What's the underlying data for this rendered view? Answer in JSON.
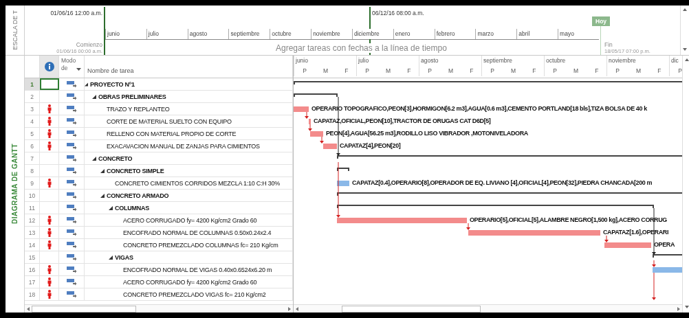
{
  "timeline": {
    "side_label": "ESCALA DE T",
    "start_marker": "01/06/16 12:00 a.m.",
    "end_marker": "06/12/16 08:00 a.m.",
    "months": [
      "junio",
      "julio",
      "agosto",
      "septiembre",
      "octubre",
      "noviembre",
      "diciembre",
      "enero",
      "febrero",
      "marzo",
      "abril",
      "mayo"
    ],
    "start_label": "Comienzo",
    "start_value": "01/06/16 00:00 a.m.",
    "hint": "Agregar tareas con fechas a la línea de tiempo",
    "today": "Hoy",
    "finish_label": "Fin",
    "finish_value": "18/05/17 07:00 p.m."
  },
  "view_label": "DIAGRAMA DE GANTT",
  "table": {
    "columns": {
      "mode": "Modo de",
      "name": "Nombre de tarea"
    },
    "rows": [
      {
        "number": "1",
        "name": "PROYECTO Nº1",
        "kind": "summary",
        "expanded": true,
        "selected": true,
        "overallocated": false,
        "children": [
          {
            "number": "2",
            "name": "OBRAS PRELIMINARES",
            "kind": "summary",
            "expanded": true,
            "selected": false,
            "overallocated": false,
            "children": [
              {
                "number": "3",
                "name": "TRAZO Y REPLANTEO",
                "kind": "task",
                "selected": false,
                "overallocated": true,
                "bar": {
                  "critical": true,
                  "resources": "OPERARIO TOPOGRAFICO,PEON[3],HORMIGON[6.2 m3],AGUA[0.6 m3],CEMENTO PORTLAND[18 bls],TIZA BOLSA DE 40 k"
                }
              },
              {
                "number": "4",
                "name": "CORTE DE MATERIAL SUELTO CON EQUIPO",
                "kind": "task",
                "selected": false,
                "overallocated": true,
                "bar": {
                  "critical": true,
                  "resources": "CAPATAZ,OFICIAL,PEON[10],TRACTOR DE ORUGAS CAT D6D[5]"
                }
              },
              {
                "number": "5",
                "name": "RELLENO CON MATERIAL PROPIO DE CORTE",
                "kind": "task",
                "selected": false,
                "overallocated": true,
                "bar": {
                  "critical": true,
                  "resources": "PEON[4],AGUA[56.25 m3],RODILLO LISO VIBRADOR ,MOTONIVELADORA"
                }
              },
              {
                "number": "6",
                "name": "EXACAVACION MANUAL DE ZANJAS PARA CIMIENTOS",
                "kind": "task",
                "selected": false,
                "overallocated": true,
                "bar": {
                  "critical": true,
                  "resources": "CAPATAZ[4],PEON[20]"
                }
              }
            ]
          },
          {
            "number": "7",
            "name": "CONCRETO",
            "kind": "summary",
            "expanded": true,
            "selected": false,
            "overallocated": false,
            "children": [
              {
                "number": "8",
                "name": "CONCRETO SIMPLE",
                "kind": "summary",
                "expanded": true,
                "selected": false,
                "overallocated": false,
                "children": [
                  {
                    "number": "9",
                    "name": "CONCRETO CIMIENTOS CORRIDOS MEZCLA 1:10 C:H 30%",
                    "kind": "task",
                    "selected": false,
                    "overallocated": true,
                    "bar": {
                      "critical": false,
                      "resources": "CAPATAZ[0.4],OPERARIO[8],OPERADOR DE EQ. LIVIANO [4],OFICIAL[4],PEON[32],PIEDRA CHANCADA[200 m"
                    }
                  }
                ]
              },
              {
                "number": "10",
                "name": "CONCRETO ARMADO",
                "kind": "summary",
                "expanded": true,
                "selected": false,
                "overallocated": false,
                "children": [
                  {
                    "number": "11",
                    "name": "COLUMNAS",
                    "kind": "summary",
                    "expanded": true,
                    "selected": false,
                    "overallocated": false,
                    "children": [
                      {
                        "number": "12",
                        "name": "ACERO CORRUGADO fy= 4200 Kg/cm2 Grado 60",
                        "kind": "task",
                        "selected": false,
                        "overallocated": true,
                        "bar": {
                          "critical": true,
                          "resources": "OPERARIO[5],OFICIAL[5],ALAMBRE NEGRO[1,500 kg],ACERO CORRUG"
                        }
                      },
                      {
                        "number": "13",
                        "name": "ENCOFRADO NORMAL DE COLUMNAS 0.50x0.24x2.4",
                        "kind": "task",
                        "selected": false,
                        "overallocated": true,
                        "bar": {
                          "critical": true,
                          "resources": "CAPATAZ[1.6],OPERARI"
                        }
                      },
                      {
                        "number": "14",
                        "name": "CONCRETO PREMEZCLADO COLUMNAS fc= 210 Kg/cm",
                        "kind": "task",
                        "selected": false,
                        "overallocated": true,
                        "bar": {
                          "critical": true,
                          "resources": "OPERA"
                        }
                      }
                    ]
                  },
                  {
                    "number": "15",
                    "name": "VIGAS",
                    "kind": "summary",
                    "expanded": true,
                    "selected": false,
                    "overallocated": false,
                    "children": [
                      {
                        "number": "16",
                        "name": "ENCOFRADO NORMAL DE VIGAS 0.40x0.6524x6.20 m",
                        "kind": "task",
                        "selected": false,
                        "overallocated": true,
                        "bar": {
                          "critical": false
                        }
                      },
                      {
                        "number": "17",
                        "name": "ACERO CORRUGADO fy= 4200 Kg/cm2 Grado 60",
                        "kind": "task",
                        "selected": false,
                        "overallocated": true
                      },
                      {
                        "number": "18",
                        "name": "CONCRETO PREMEZCLADO VIGAS  fc= 210 Kg/cm2",
                        "kind": "task",
                        "selected": false,
                        "overallocated": true
                      }
                    ]
                  }
                ]
              }
            ]
          }
        ]
      }
    ]
  },
  "gantt": {
    "months": [
      {
        "label": "junio",
        "thirds": [
          "P",
          "M",
          "F"
        ]
      },
      {
        "label": "julio",
        "thirds": [
          "P",
          "M",
          "F"
        ]
      },
      {
        "label": "agosto",
        "thirds": [
          "P",
          "M",
          "F"
        ]
      },
      {
        "label": "septiembre",
        "thirds": [
          "P",
          "M",
          "F"
        ]
      },
      {
        "label": "octubre",
        "thirds": [
          "P",
          "M",
          "F"
        ]
      },
      {
        "label": "noviembre",
        "thirds": [
          "P",
          "M",
          "F"
        ]
      },
      {
        "label": "dic",
        "thirds": [
          "P"
        ]
      }
    ]
  }
}
